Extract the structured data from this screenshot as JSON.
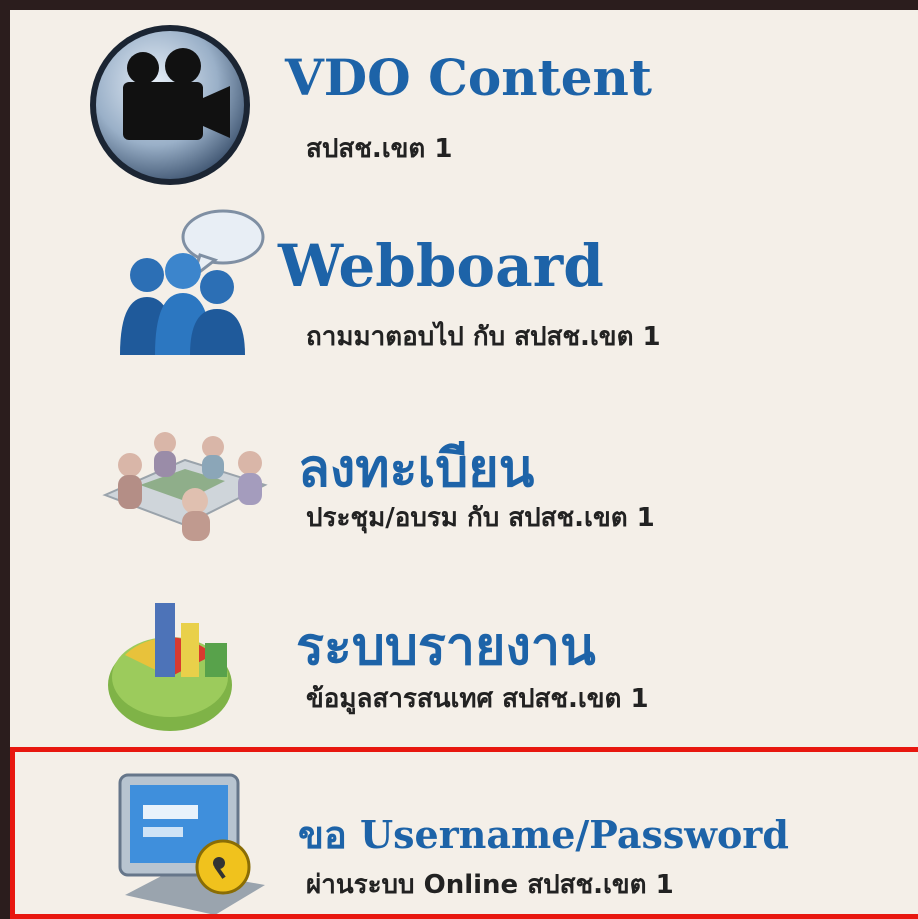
{
  "menu": {
    "items": [
      {
        "title": "VDO Content",
        "subtitle": "สปสช.เขต 1",
        "icon": "video-camera-icon"
      },
      {
        "title": "Webboard",
        "subtitle": "ถามมาตอบไป กับ สปสช.เขต 1",
        "icon": "webboard-people-icon"
      },
      {
        "title": "ลงทะเบียน",
        "subtitle": "ประชุม/อบรม กับ สปสช.เขต 1",
        "icon": "meeting-table-icon"
      },
      {
        "title": "ระบบรายงาน",
        "subtitle": "ข้อมูลสารสนเทศ สปสช.เขต 1",
        "icon": "report-chart-icon"
      },
      {
        "title": "ขอ Username/Password",
        "subtitle": "ผ่านระบบ Online สปสช.เขต 1",
        "icon": "computer-lock-icon"
      }
    ]
  },
  "colors": {
    "title": "#1d63a8",
    "highlight": "#e8170f",
    "background": "#f4efe8"
  }
}
